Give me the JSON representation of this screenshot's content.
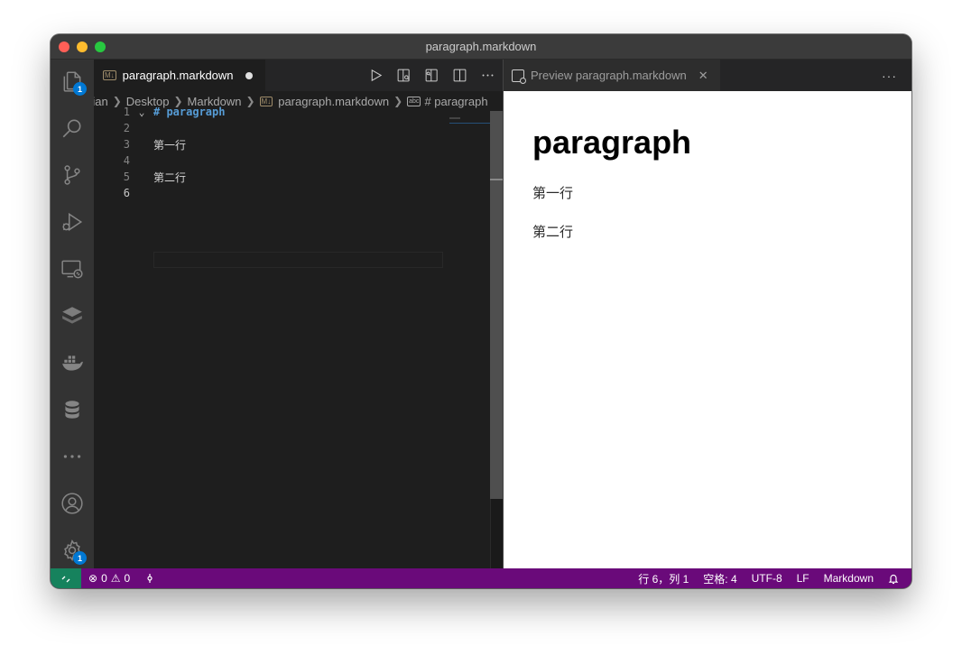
{
  "window": {
    "title": "paragraph.markdown"
  },
  "activity_bar": {
    "items": [
      {
        "name": "explorer",
        "badge": "1"
      },
      {
        "name": "search"
      },
      {
        "name": "source-control"
      },
      {
        "name": "run-and-debug"
      },
      {
        "name": "remote-explorer"
      },
      {
        "name": "extensions"
      },
      {
        "name": "docker"
      },
      {
        "name": "database"
      },
      {
        "name": "more"
      }
    ],
    "bottom": [
      {
        "name": "accounts"
      },
      {
        "name": "manage",
        "badge": "1"
      }
    ]
  },
  "editor": {
    "tab": {
      "label": "paragraph.markdown",
      "icon": "M↓",
      "dirty": true
    },
    "breadcrumb": [
      "rian",
      "Desktop",
      "Markdown",
      "paragraph.markdown",
      "# paragraph"
    ],
    "breadcrumb_file_icon": "M↓",
    "breadcrumb_symbol_icon": "abc",
    "lines": [
      {
        "num": "1",
        "text": "# paragraph",
        "kind": "heading",
        "foldable": true
      },
      {
        "num": "2",
        "text": ""
      },
      {
        "num": "3",
        "text": "第一行"
      },
      {
        "num": "4",
        "text": ""
      },
      {
        "num": "5",
        "text": "第二行"
      },
      {
        "num": "6",
        "text": "",
        "active": true
      }
    ]
  },
  "preview": {
    "tab_label": "Preview paragraph.markdown",
    "heading": "paragraph",
    "paragraphs": [
      "第一行",
      "第二行"
    ]
  },
  "status_bar": {
    "errors": "0",
    "warnings": "0",
    "position": "行 6，列 1",
    "spaces": "空格: 4",
    "encoding": "UTF-8",
    "eol": "LF",
    "language": "Markdown"
  },
  "colors": {
    "status_bar": "#6a0a7a",
    "remote": "#16825d",
    "badge": "#0078d4"
  }
}
